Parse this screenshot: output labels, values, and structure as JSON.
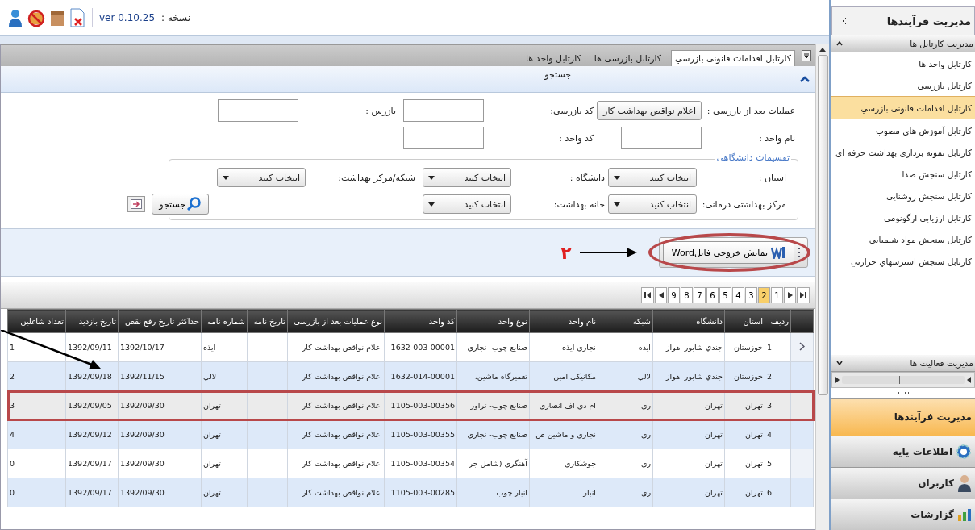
{
  "top_bar": {
    "version_label": "نسخه :",
    "version": "ver 0.10.25"
  },
  "tabs": [
    {
      "label": "کارتابل اقدامات قانونی بازرسي",
      "selected": true
    },
    {
      "label": "کارتابل بازرسی ها",
      "selected": false
    },
    {
      "label": "کارتابل واحد ها",
      "selected": false
    }
  ],
  "search_panel": {
    "title": "جستجو",
    "expanded": true
  },
  "form": {
    "rows": [
      [
        {
          "kind": "select",
          "label": "عملیات بعد از بازرسی :",
          "value": "اعلام نواقص بهداشت کار"
        },
        {
          "kind": "input",
          "label": "کد بازرسی:"
        },
        {
          "kind": "input",
          "label": "بازرس :"
        }
      ],
      [
        {
          "kind": "input",
          "label": "نام واحد :"
        },
        {
          "kind": "input",
          "label": "کد واحد :"
        }
      ]
    ]
  },
  "divisions": {
    "legend": "تقسیمات دانشگاهی",
    "rows": [
      [
        {
          "label": "استان :",
          "value": "انتخاب کنید"
        },
        {
          "label": "دانشگاه :",
          "value": "انتخاب کنید"
        },
        {
          "label": "شبکه/مرکز بهداشت:",
          "value": "انتخاب کنید"
        }
      ],
      [
        {
          "label": "مرکز بهداشتی درمانی:",
          "value": "انتخاب کنید"
        },
        {
          "label": "خانه بهداشت:",
          "value": "انتخاب کنید"
        }
      ]
    ],
    "search_button": "جستجو"
  },
  "toolbar": {
    "word_button": "نمایش خروجی فایلWord",
    "circled": true,
    "note": "۲"
  },
  "pager": {
    "pages": [
      {
        "label": "1",
        "selected": false
      },
      {
        "label": "2",
        "selected": true
      },
      {
        "label": "3",
        "selected": false
      },
      {
        "label": "4",
        "selected": false
      },
      {
        "label": "5",
        "selected": false
      },
      {
        "label": "6",
        "selected": false
      },
      {
        "label": "7",
        "selected": false
      },
      {
        "label": "8",
        "selected": false
      },
      {
        "label": "9",
        "selected": false
      }
    ]
  },
  "table": {
    "columns": [
      "ردیف",
      "استان",
      "دانشگاه",
      "شبکه",
      "نام واحد",
      "نوع واحد",
      "کد واحد",
      "نوع عملیات بعد از بازرسی",
      "تاریخ نامه",
      "شماره نامه",
      "حداکثر تاریخ رفع نقص",
      "تاریخ بازدید",
      "تعداد شاغلین"
    ],
    "rows": [
      {
        "current": true,
        "selected": false,
        "outlined": false,
        "cells": [
          "1",
          "خوزستان",
          "جندي شابور اهواز",
          "ایذه",
          "نجاری ایذه",
          "صنایع چوب- نجاری",
          "1632-003-00001",
          "اعلام نواقص بهداشت کار",
          null,
          "ایذه",
          "1392/10/17",
          "1392/09/11",
          "1"
        ]
      },
      {
        "current": false,
        "selected": false,
        "outlined": false,
        "cells": [
          "2",
          "خوزستان",
          "جندي شابور اهواز",
          "لالي",
          "مکانیکی امین",
          "تعمیرگاه ماشین،",
          "1632-014-00001",
          "اعلام نواقص بهداشت کار",
          null,
          "لالي",
          "1392/11/15",
          "1392/09/18",
          "2"
        ]
      },
      {
        "current": false,
        "selected": true,
        "outlined": true,
        "cells": [
          "3",
          "تهران",
          "تهران",
          "ری",
          "ام دی اف انصاری",
          "صنایع چوب- تراور",
          "1105-003-00356",
          "اعلام نواقص بهداشت کار",
          null,
          "تهران",
          "1392/09/30",
          "1392/09/05",
          "3"
        ]
      },
      {
        "current": false,
        "selected": false,
        "outlined": false,
        "cells": [
          "4",
          "تهران",
          "تهران",
          "ری",
          "نجاری و ماشین ص",
          "صنایع چوب- نجاری",
          "1105-003-00355",
          "اعلام نواقص بهداشت کار",
          null,
          "تهران",
          "1392/09/30",
          "1392/09/12",
          "4"
        ]
      },
      {
        "current": false,
        "selected": false,
        "outlined": false,
        "cells": [
          "5",
          "تهران",
          "تهران",
          "ری",
          "جوشکاری",
          "آهنگری (شامل جر",
          "1105-003-00354",
          "اعلام نواقص بهداشت کار",
          null,
          "تهران",
          "1392/09/30",
          "1392/09/17",
          "0"
        ]
      },
      {
        "current": false,
        "selected": false,
        "outlined": false,
        "cells": [
          "6",
          "تهران",
          "تهران",
          "ری",
          "انبار",
          "انبار چوب",
          "1105-003-00285",
          "اعلام نواقص بهداشت کار",
          null,
          "تهران",
          "1392/09/30",
          "1392/09/17",
          "0"
        ]
      }
    ]
  },
  "sidebar": {
    "title": "مدیریت فرآیندها",
    "sections": [
      {
        "title": "مدیریت کارتابل ها",
        "expanded": true,
        "items": [
          {
            "label": "کارتابل واحد ها",
            "selected": false
          },
          {
            "label": "کارتابل بازرسی",
            "selected": false
          },
          {
            "label": "کارتابل اقدامات قانونی بازرسي",
            "selected": true
          },
          {
            "label": "کارتابل آموزش هاى مصوب",
            "selected": false
          },
          {
            "label": "کارتابل نمونه بردارى بهداشت حرفه اى",
            "selected": false
          },
          {
            "label": "کارتابل سنجش صدا",
            "selected": false
          },
          {
            "label": "کارتابل سنجش روشنايى",
            "selected": false
          },
          {
            "label": "کارتابل ارزيابي ارگونومي",
            "selected": false
          },
          {
            "label": "کارتابل سنجش مواد شيميايى",
            "selected": false
          },
          {
            "label": "کارتابل  سنجش استرسهاي حرارتي",
            "selected": false
          }
        ]
      },
      {
        "title": "مدیریت فعالیت ها",
        "expanded": false
      }
    ],
    "nav": [
      {
        "kind": "plain",
        "label": "مدیریت فرآیندها",
        "selected": true
      },
      {
        "kind": "gear",
        "label": "اطلاعات پایه",
        "selected": false
      },
      {
        "kind": "user",
        "label": "کاربران",
        "selected": false
      },
      {
        "kind": "chart",
        "label": "گزارشات",
        "selected": false
      }
    ]
  }
}
